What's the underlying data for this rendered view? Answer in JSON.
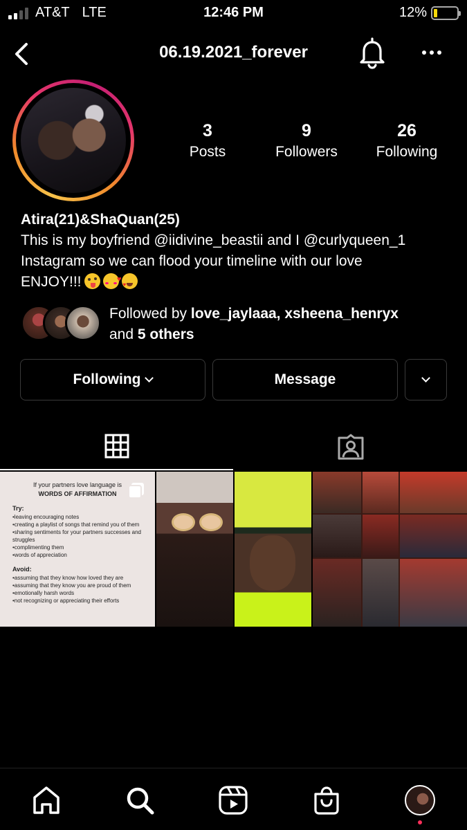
{
  "status_bar": {
    "carrier": "AT&T",
    "network": "LTE",
    "time": "12:46 PM",
    "battery": "12%",
    "battery_color": "#f5d90a"
  },
  "header": {
    "title": "06.19.2021_forever",
    "icons": [
      "back-arrow-icon",
      "bell-icon",
      "more-horizontal-icon"
    ]
  },
  "profile": {
    "stats": {
      "posts_count": "3",
      "posts_label": "Posts",
      "followers_count": "9",
      "followers_label": "Followers",
      "following_count": "26",
      "following_label": "Following"
    },
    "bio": {
      "name": "Atira(21)&ShaQuan(25)",
      "line1": "This is my boyfriend @iidivine_beastii and I @curlyqueen_1",
      "line2": "Instagram so we can flood your timeline with our love",
      "line3": "ENJOY!!!"
    },
    "followed_by": {
      "prefix": "Followed by",
      "users": "love_jaylaaa, xsheena_henryx",
      "and": "and",
      "others": "5 others"
    }
  },
  "actions": {
    "following_label": "Following",
    "message_label": "Message"
  },
  "tabs": [
    "grid-icon",
    "tagged-icon"
  ],
  "posts": {
    "post1": {
      "header_line": "If your partners love language is",
      "header_bold": "WORDS OF AFFIRMATION",
      "try_label": "Try:",
      "try_items": "•leaving encouraging notes\n•creating a playlist of songs that remind you of them\n•sharing sentiments for your partners successes and struggles\n•complimenting them\n•words of appreciation",
      "avoid_label": "Avoid:",
      "avoid_items": "•assuming that they know how loved they are\n•assuming that they know you are proud of them\n•emotionally harsh words\n•not recognizing or appreciating their efforts"
    }
  },
  "bottom_nav": [
    "home-icon",
    "search-icon",
    "reels-icon",
    "shop-icon",
    "profile-avatar"
  ],
  "colors": {
    "background": "#000000",
    "ring_gradient": [
      "#f7c24a",
      "#f08a2b",
      "#e3356b",
      "#c41f73"
    ],
    "notification_dot": "#ff2f5a"
  }
}
